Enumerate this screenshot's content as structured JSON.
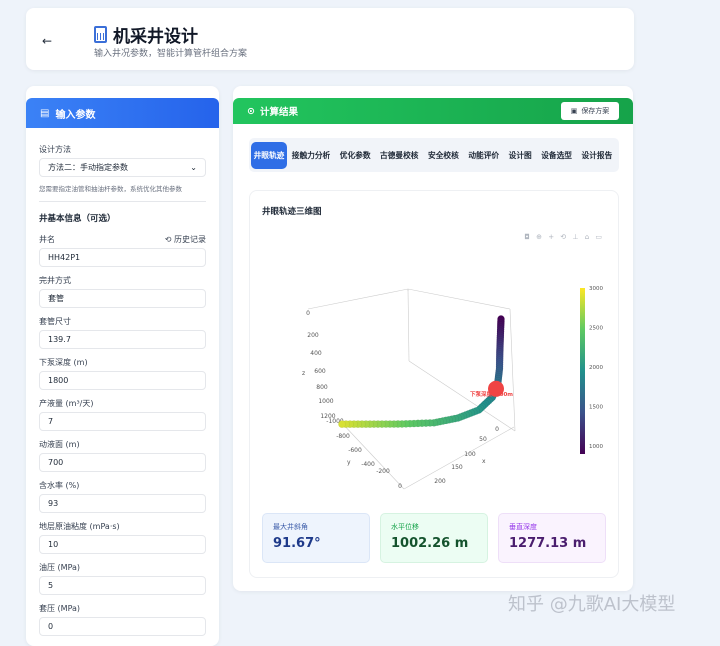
{
  "header": {
    "back_icon": "arrow-left-icon",
    "title": "机采井设计",
    "subtitle": "输入井况参数，智能计算管杆组合方案"
  },
  "input_panel": {
    "title": "输入参数",
    "design_method_label": "设计方法",
    "design_method_value": "方法二：手动指定参数",
    "hint": "您需要指定油管和抽油杆参数，系统优化其他参数",
    "section_title": "井基本信息（可选）",
    "history_label": "历史记录",
    "fields": [
      {
        "label": "井名",
        "value": "HH42P1"
      },
      {
        "label": "完井方式",
        "value": "套管"
      },
      {
        "label": "套管尺寸",
        "value": "139.7"
      },
      {
        "label": "下泵深度 (m)",
        "value": "1800"
      },
      {
        "label": "产液量 (m³/天)",
        "value": "7"
      },
      {
        "label": "动液面 (m)",
        "value": "700"
      },
      {
        "label": "含水率 (%)",
        "value": "93"
      },
      {
        "label": "地层原油粘度 (mPa·s)",
        "value": "10"
      },
      {
        "label": "油压 (MPa)",
        "value": "5"
      },
      {
        "label": "套压 (MPa)",
        "value": "0"
      }
    ]
  },
  "results_panel": {
    "title": "计算结果",
    "save_label": "保存方案",
    "tabs": [
      "井眼轨迹",
      "接触力分析",
      "优化参数",
      "古德曼校核",
      "安全校核",
      "动能评价",
      "设计图",
      "设备选型",
      "设计报告"
    ],
    "plot_title": "井眼轨迹三维图",
    "stats": [
      {
        "label": "最大井斜角",
        "value": "91.67°"
      },
      {
        "label": "水平位移",
        "value": "1002.26 m"
      },
      {
        "label": "垂直深度",
        "value": "1277.13 m"
      }
    ]
  },
  "chart_data": {
    "type": "scatter3d",
    "title": "井眼轨迹三维图",
    "xlabel": "x",
    "ylabel": "y",
    "zlabel": "z",
    "x_ticks": [
      "0",
      "50",
      "100",
      "150",
      "200"
    ],
    "y_ticks": [
      "-1000",
      "-800",
      "-600",
      "-400",
      "-200",
      "0"
    ],
    "z_ticks": [
      "0",
      "200",
      "400",
      "600",
      "800",
      "1000",
      "1200"
    ],
    "colorbar_ticks": [
      "1000",
      "1500",
      "2000",
      "2500",
      "3000"
    ],
    "color_range": [
      900,
      3000
    ],
    "trajectory": [
      [
        0,
        0,
        0,
        900
      ],
      [
        2,
        0,
        200,
        1100
      ],
      [
        4,
        0,
        400,
        1300
      ],
      [
        5,
        0,
        600,
        1500
      ],
      [
        6,
        -10,
        800,
        1700
      ],
      [
        8,
        -40,
        950,
        1850
      ],
      [
        10,
        -120,
        1100,
        2000
      ],
      [
        10,
        -250,
        1200,
        2150
      ],
      [
        10,
        -400,
        1260,
        2300
      ],
      [
        10,
        -600,
        1275,
        2500
      ],
      [
        10,
        -800,
        1277,
        2700
      ],
      [
        10,
        -1000,
        1277,
        2900
      ]
    ],
    "marker": {
      "label": "下泵深度1800m",
      "x": 6,
      "y": -20,
      "z": 850,
      "color": "#ef4444"
    }
  },
  "watermark": "知乎 @九歌AI大模型"
}
